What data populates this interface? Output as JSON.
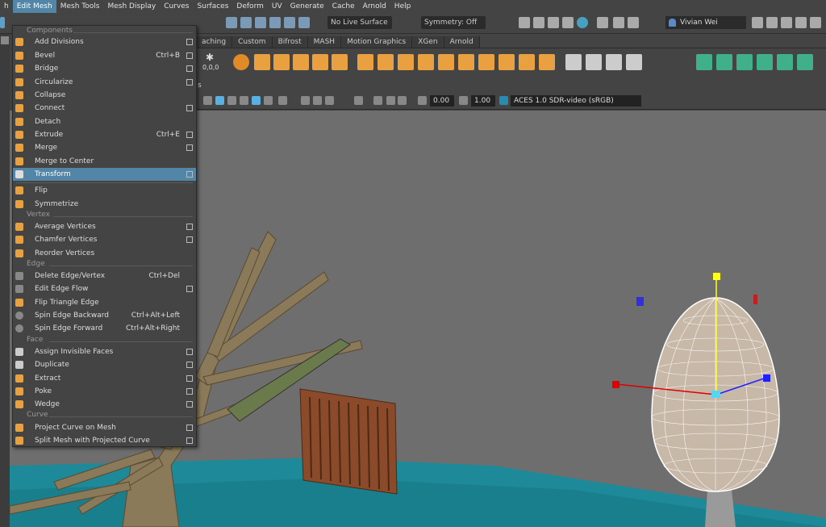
{
  "menubar": {
    "items": [
      "h",
      "Edit Mesh",
      "Mesh Tools",
      "Mesh Display",
      "Curves",
      "Surfaces",
      "Deform",
      "UV",
      "Generate",
      "Cache",
      "Arnold",
      "Help"
    ]
  },
  "statusline": {
    "live_surface": "No Live Surface",
    "symmetry": "Symmetry: Off",
    "user": "Vivian Wei"
  },
  "shelf": {
    "tabs": [
      "aching",
      "Custom",
      "Bifrost",
      "MASH",
      "Motion Graphics",
      "XGen",
      "Arnold"
    ],
    "coord_label": "0,0,0"
  },
  "panel": {
    "menu_fragment": "s",
    "exposure": "0.00",
    "gamma": "1.00",
    "colorspace": "ACES 1.0 SDR-video (sRGB)"
  },
  "menu": {
    "sections": {
      "components": "Components",
      "vertex": "Vertex",
      "edge": "Edge",
      "face": "Face",
      "curve": "Curve"
    },
    "items": [
      {
        "label": "Add Divisions",
        "shortcut": "",
        "option": true
      },
      {
        "label": "Bevel",
        "shortcut": "Ctrl+B",
        "option": true
      },
      {
        "label": "Bridge",
        "shortcut": "",
        "option": true
      },
      {
        "label": "Circularize",
        "shortcut": "",
        "option": true
      },
      {
        "label": "Collapse",
        "shortcut": "",
        "option": false
      },
      {
        "label": "Connect",
        "shortcut": "",
        "option": true
      },
      {
        "label": "Detach",
        "shortcut": "",
        "option": false
      },
      {
        "label": "Extrude",
        "shortcut": "Ctrl+E",
        "option": true
      },
      {
        "label": "Merge",
        "shortcut": "",
        "option": true
      },
      {
        "label": "Merge to Center",
        "shortcut": "",
        "option": false
      },
      {
        "label": "Transform",
        "shortcut": "",
        "option": true
      },
      {
        "label": "Flip",
        "shortcut": "",
        "option": false
      },
      {
        "label": "Symmetrize",
        "shortcut": "",
        "option": false
      },
      {
        "label": "Average Vertices",
        "shortcut": "",
        "option": true
      },
      {
        "label": "Chamfer Vertices",
        "shortcut": "",
        "option": true
      },
      {
        "label": "Reorder Vertices",
        "shortcut": "",
        "option": false
      },
      {
        "label": "Delete Edge/Vertex",
        "shortcut": "Ctrl+Del",
        "option": false
      },
      {
        "label": "Edit Edge Flow",
        "shortcut": "",
        "option": true
      },
      {
        "label": "Flip Triangle Edge",
        "shortcut": "",
        "option": false
      },
      {
        "label": "Spin Edge Backward",
        "shortcut": "Ctrl+Alt+Left",
        "option": false
      },
      {
        "label": "Spin Edge Forward",
        "shortcut": "Ctrl+Alt+Right",
        "option": false
      },
      {
        "label": "Assign Invisible Faces",
        "shortcut": "",
        "option": true
      },
      {
        "label": "Duplicate",
        "shortcut": "",
        "option": true
      },
      {
        "label": "Extract",
        "shortcut": "",
        "option": true
      },
      {
        "label": "Poke",
        "shortcut": "",
        "option": true
      },
      {
        "label": "Wedge",
        "shortcut": "",
        "option": true
      },
      {
        "label": "Project Curve on Mesh",
        "shortcut": "",
        "option": true
      },
      {
        "label": "Split Mesh with Projected Curve",
        "shortcut": "",
        "option": true
      }
    ]
  },
  "colors": {
    "highlight": "#5285a6",
    "water": "#1e8a99",
    "manip_x": "#e00000",
    "manip_y": "#ffff20",
    "manip_z": "#2020ff",
    "pivot": "#5ad4f0"
  }
}
